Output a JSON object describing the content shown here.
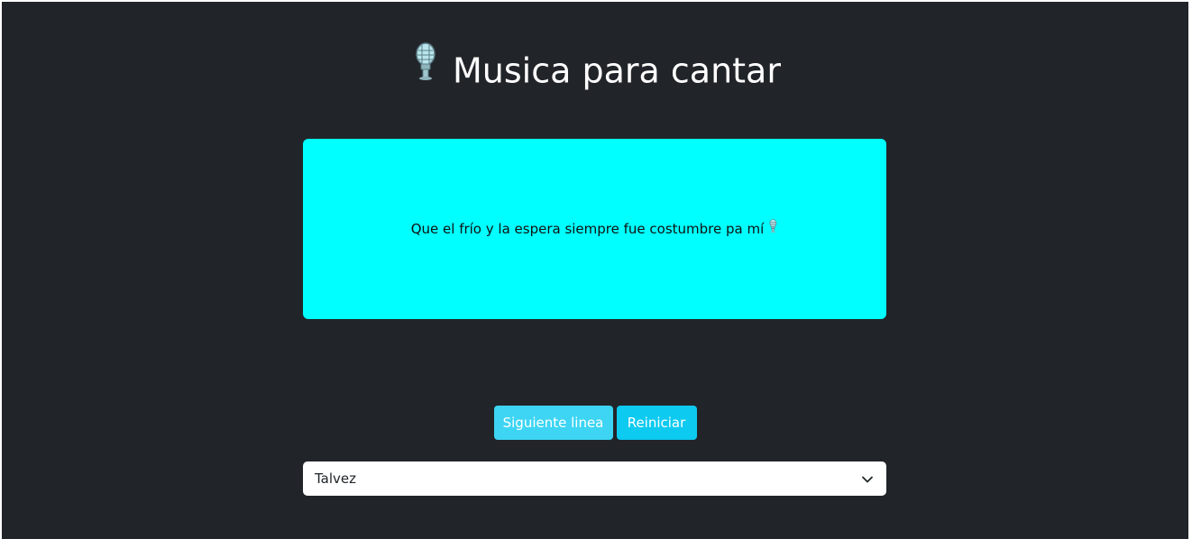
{
  "header": {
    "title": "Musica para cantar",
    "icon": "microphone-icon"
  },
  "lyrics": {
    "current_line": "Que el frío y la espera siempre fue costumbre pa mí",
    "line_icon": "microphone-icon",
    "card_color": "#00ffff"
  },
  "controls": {
    "next_label": "Siguiente linea",
    "next_color": "#3dd5f3",
    "reset_label": "Reiniciar",
    "reset_color": "#0dcaf0"
  },
  "song_select": {
    "selected": "Talvez",
    "icon": "chevron-down-icon"
  },
  "theme": {
    "background": "#212529",
    "text": "#ffffff"
  }
}
